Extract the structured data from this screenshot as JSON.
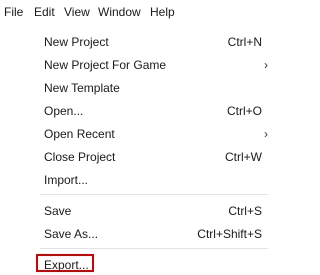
{
  "menubar": {
    "items": [
      {
        "label": "File"
      },
      {
        "label": "Edit"
      },
      {
        "label": "View"
      },
      {
        "label": "Window"
      },
      {
        "label": "Help"
      }
    ]
  },
  "file_menu": {
    "items": [
      {
        "label": "New Project",
        "shortcut": "Ctrl+N"
      },
      {
        "label": "New Project For Game",
        "submenu_arrow": "›"
      },
      {
        "label": "New Template"
      },
      {
        "label": "Open...",
        "shortcut": "Ctrl+O"
      },
      {
        "label": "Open Recent",
        "submenu_arrow": "›"
      },
      {
        "label": "Close Project",
        "shortcut": "Ctrl+W"
      },
      {
        "label": "Import..."
      },
      {
        "label": "Save",
        "shortcut": "Ctrl+S"
      },
      {
        "label": "Save As...",
        "shortcut": "Ctrl+Shift+S"
      },
      {
        "label": "Export..."
      }
    ],
    "highlighted_item": "Export...",
    "highlight_color": "#d40000"
  }
}
